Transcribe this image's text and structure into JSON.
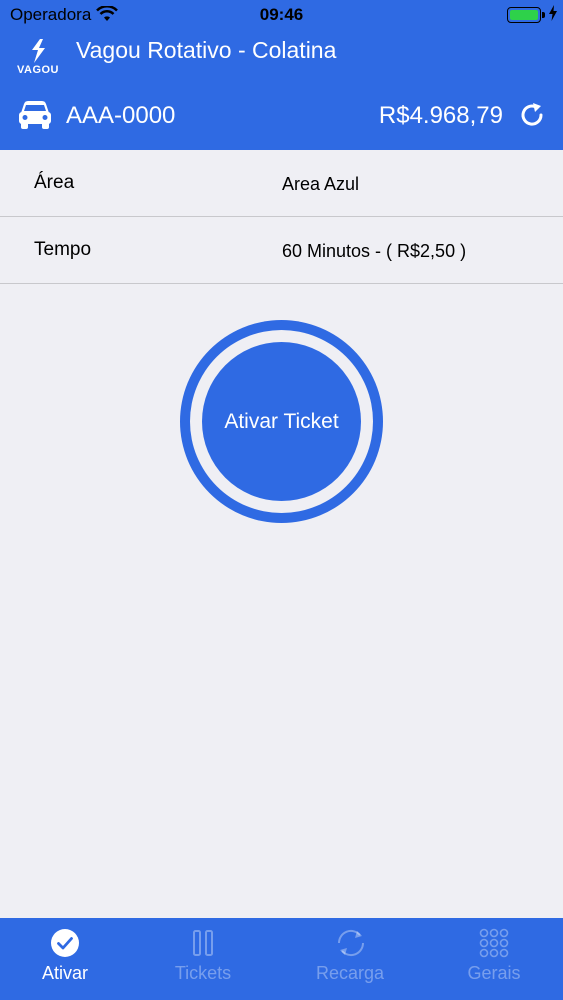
{
  "status_bar": {
    "carrier": "Operadora",
    "time": "09:46"
  },
  "header": {
    "logo_text": "VAGOU",
    "title": "Vagou Rotativo - Colatina",
    "plate": "AAA-0000",
    "balance": "R$4.968,79"
  },
  "form": {
    "area": {
      "label": "Área",
      "value": "Area Azul"
    },
    "tempo": {
      "label": "Tempo",
      "value": "60 Minutos - ( R$2,50 )"
    }
  },
  "activate_button": {
    "label": "Ativar Ticket"
  },
  "tabbar": {
    "tabs": [
      {
        "label": "Ativar",
        "icon": "check-circle-icon",
        "active": true
      },
      {
        "label": "Tickets",
        "icon": "pause-icon",
        "active": false
      },
      {
        "label": "Recarga",
        "icon": "refresh-circle-icon",
        "active": false
      },
      {
        "label": "Gerais",
        "icon": "grid-icon",
        "active": false
      }
    ]
  },
  "colors": {
    "primary": "#2f6ae3",
    "background": "#efeff4",
    "divider": "#c8c8cc",
    "battery": "#2ed14a"
  }
}
